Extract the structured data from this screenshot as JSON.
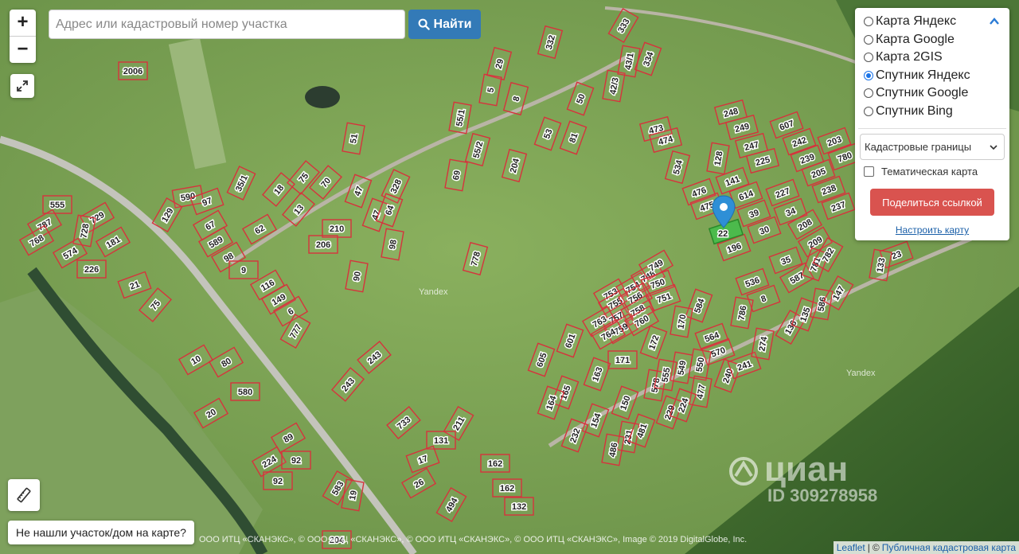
{
  "search": {
    "placeholder": "Адрес или кадастровый номер участка",
    "button_label": "Найти"
  },
  "zoom": {
    "in_label": "+",
    "out_label": "−"
  },
  "layers": {
    "options": [
      {
        "label": "Карта Яндекс",
        "selected": false
      },
      {
        "label": "Карта Google",
        "selected": false
      },
      {
        "label": "Карта 2GIS",
        "selected": false
      },
      {
        "label": "Спутник Яндекс",
        "selected": true
      },
      {
        "label": "Спутник Google",
        "selected": false
      },
      {
        "label": "Спутник Bing",
        "selected": false
      }
    ],
    "overlay_select": "Кадастровые границы",
    "thematic_checkbox": "Тематическая карта",
    "thematic_checked": false,
    "share_button": "Поделиться ссылкой",
    "configure_link": "Настроить карту"
  },
  "not_found_button": "Не нашли участок/дом на карте?",
  "attribution": {
    "left": "ООО ИТЦ «СКАНЭКС», © ООО ИТЦ «СКАНЭКС», © ООО ИТЦ «СКАНЭКС», © ООО ИТЦ «СКАНЭКС», Image © 2019 DigitalGlobe, Inc.",
    "leaflet": "Leaflet",
    "sep": "|",
    "copyright": "©",
    "source": "Публичная кадастровая карта"
  },
  "watermarks": {
    "yandex": "Yandex",
    "cian": "циан",
    "cian_id": "ID 309278958"
  },
  "marker_parcel": "22",
  "parcel_labels": [
    "333",
    "332",
    "29",
    "5",
    "8",
    "42/3",
    "43/1",
    "334",
    "2006",
    "55/1",
    "55/2",
    "69",
    "204",
    "53",
    "81",
    "50",
    "51",
    "35/1",
    "75",
    "70",
    "18",
    "13",
    "328",
    "47",
    "47",
    "64",
    "555",
    "590",
    "97",
    "729",
    "129",
    "787",
    "728",
    "181",
    "768",
    "574",
    "226",
    "589",
    "67",
    "98",
    "62",
    "9",
    "210",
    "206",
    "98",
    "90",
    "778",
    "116",
    "149",
    "21",
    "75",
    "6",
    "777",
    "10",
    "80",
    "243",
    "243",
    "580",
    "20",
    "733",
    "211",
    "131",
    "17",
    "26",
    "162",
    "162",
    "132",
    "494",
    "89",
    "224",
    "92",
    "92",
    "583",
    "19",
    "204",
    "473",
    "474",
    "534",
    "248",
    "249",
    "247",
    "225",
    "607",
    "242",
    "239",
    "203",
    "780",
    "128",
    "141",
    "476",
    "475",
    "614",
    "39",
    "30",
    "205",
    "238",
    "227",
    "34",
    "208",
    "209",
    "237",
    "196",
    "536",
    "587",
    "781",
    "782",
    "35",
    "8",
    "23",
    "133",
    "753",
    "754",
    "748",
    "749",
    "750",
    "751",
    "755",
    "756",
    "757",
    "758",
    "759",
    "760",
    "584",
    "763",
    "764",
    "170",
    "601",
    "605",
    "171",
    "172",
    "564",
    "570",
    "549",
    "578",
    "555",
    "550",
    "477",
    "240",
    "241",
    "274",
    "786",
    "136",
    "135",
    "586",
    "147",
    "163",
    "165",
    "164",
    "154",
    "150",
    "232",
    "231",
    "486",
    "481",
    "229",
    "224"
  ]
}
